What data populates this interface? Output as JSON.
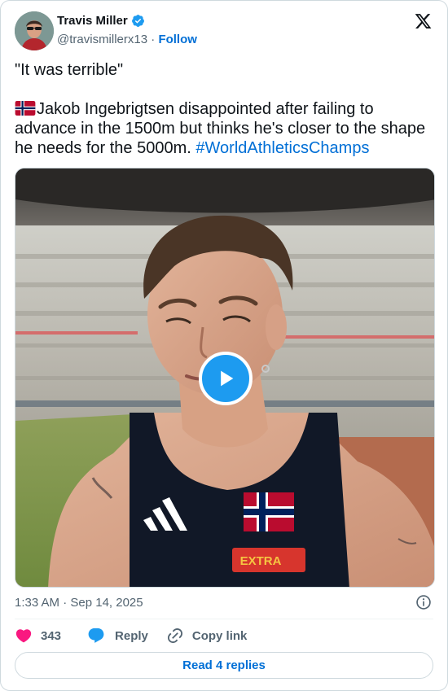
{
  "author": {
    "name": "Travis Miller",
    "handle": "@travismillerx13",
    "separator": "·",
    "follow_label": "Follow",
    "verified": true
  },
  "tweet": {
    "line1": "\"It was terrible\"",
    "body": "Jakob Ingebrigtsen disappointed after failing to advance in the 1500m but thinks he's closer to the shape he needs for the 5000m.",
    "hashtag": "#WorldAthleticsChamps",
    "flag": "norway-flag"
  },
  "media": {
    "type": "video",
    "sponsor_label": "EXTRA"
  },
  "meta": {
    "timestamp": "1:33 AM · Sep 14, 2025"
  },
  "actions": {
    "like_count": "343",
    "reply_label": "Reply",
    "copy_label": "Copy link"
  },
  "read_replies_label": "Read 4 replies",
  "colors": {
    "accent": "#1d9bf0",
    "link": "#006fd6",
    "like": "#f91880",
    "muted": "#536471"
  }
}
